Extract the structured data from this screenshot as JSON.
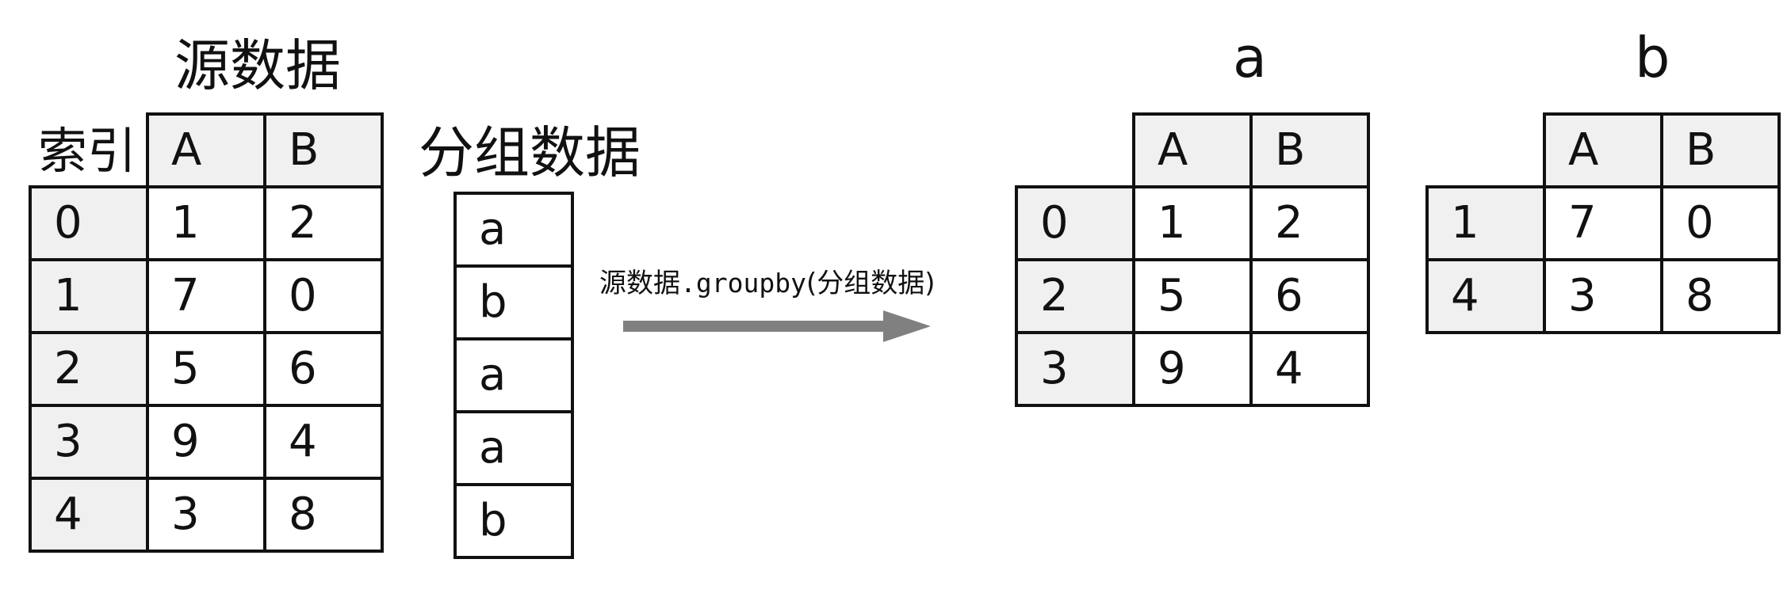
{
  "source": {
    "title": "源数据",
    "index_label": "索引",
    "columns": [
      "A",
      "B"
    ],
    "rows": [
      {
        "index": "0",
        "A": "1",
        "B": "2"
      },
      {
        "index": "1",
        "A": "7",
        "B": "0"
      },
      {
        "index": "2",
        "A": "5",
        "B": "6"
      },
      {
        "index": "3",
        "A": "9",
        "B": "4"
      },
      {
        "index": "4",
        "A": "3",
        "B": "8"
      }
    ]
  },
  "group_keys": {
    "title": "分组数据",
    "values": [
      "a",
      "b",
      "a",
      "a",
      "b"
    ]
  },
  "operation": {
    "prefix": "源数据",
    "method": ".groupby",
    "argument": "(分组数据)"
  },
  "groups": [
    {
      "name": "a",
      "columns": [
        "A",
        "B"
      ],
      "rows": [
        {
          "index": "0",
          "A": "1",
          "B": "2"
        },
        {
          "index": "2",
          "A": "5",
          "B": "6"
        },
        {
          "index": "3",
          "A": "9",
          "B": "4"
        }
      ]
    },
    {
      "name": "b",
      "columns": [
        "A",
        "B"
      ],
      "rows": [
        {
          "index": "1",
          "A": "7",
          "B": "0"
        },
        {
          "index": "4",
          "A": "3",
          "B": "8"
        }
      ]
    }
  ],
  "colors": {
    "arrow": "#808080",
    "header_fill": "#f0f0f0",
    "border": "#111111"
  }
}
